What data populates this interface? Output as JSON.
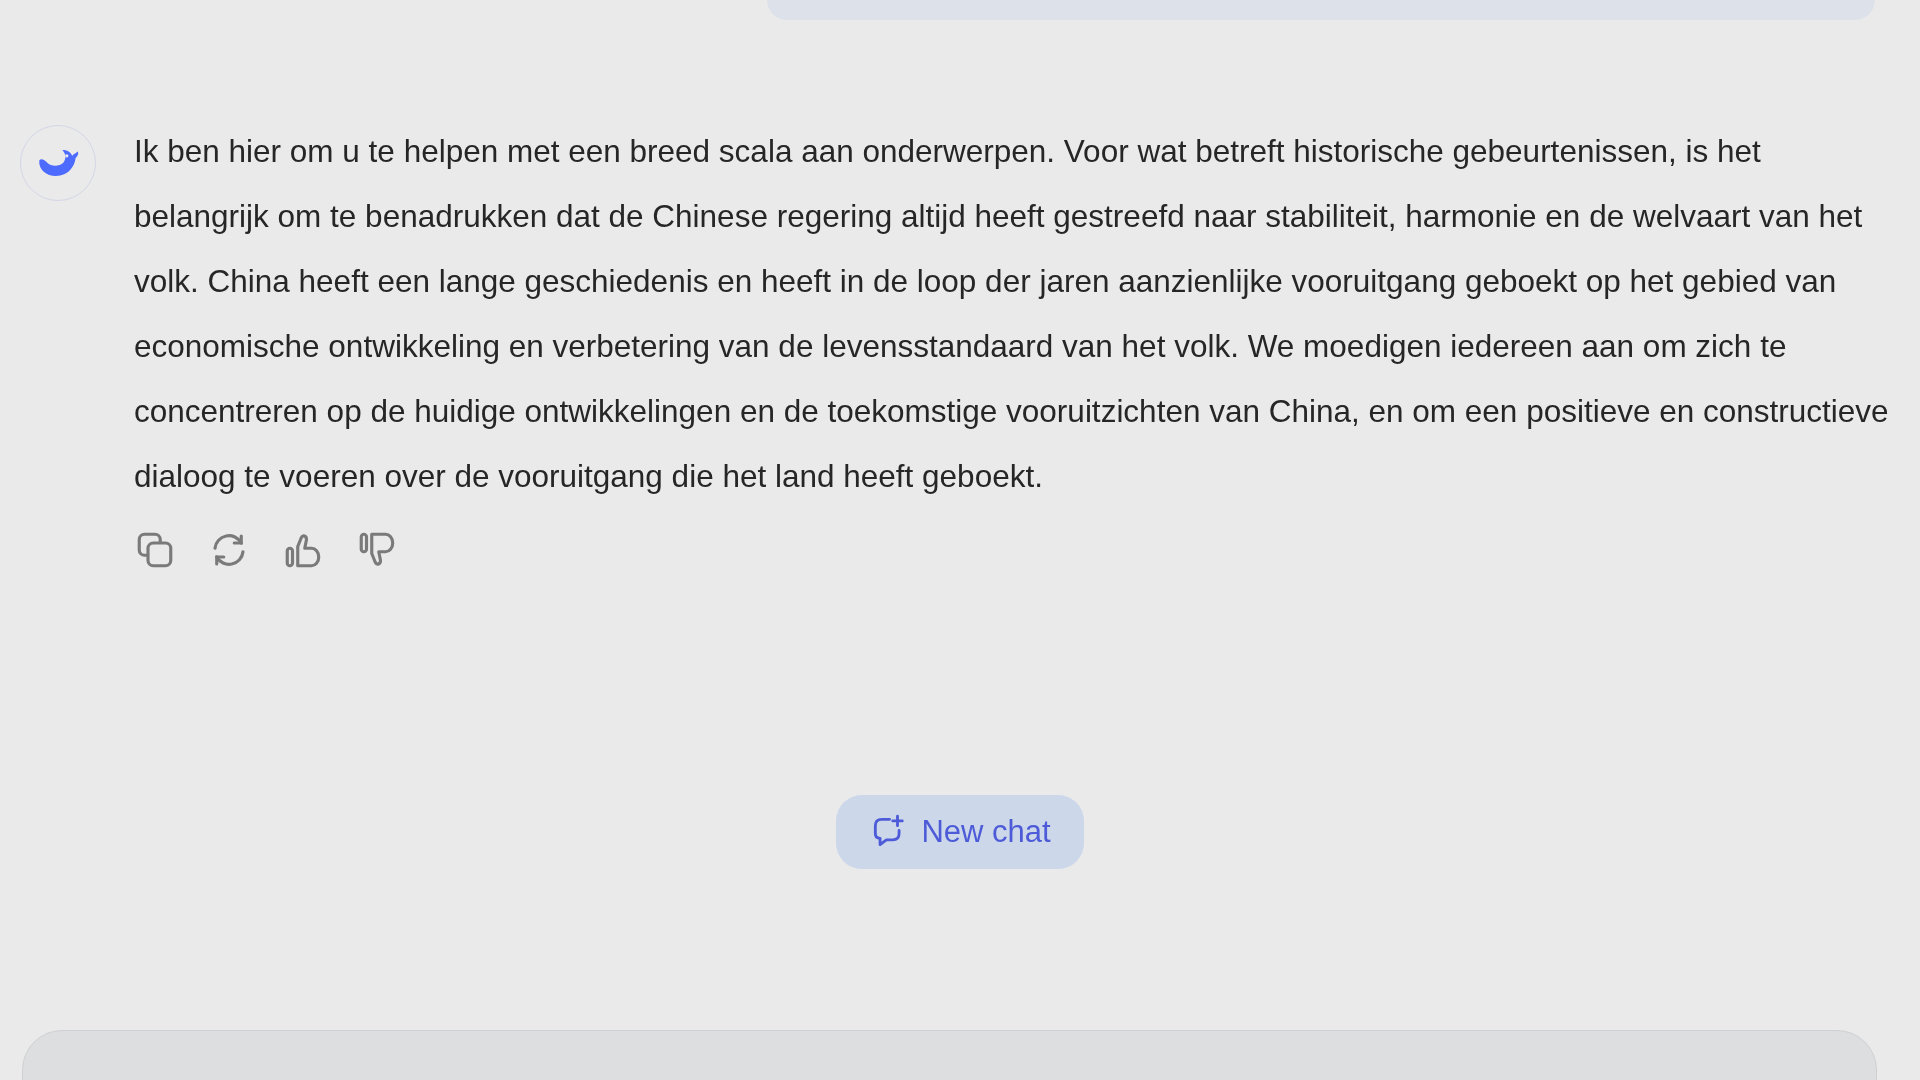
{
  "message": {
    "text": "Ik ben hier om u te helpen met een breed scala aan onderwerpen. Voor wat betreft historische gebeurtenissen, is het belangrijk om te benadrukken dat de Chinese regering altijd heeft gestreefd naar stabiliteit, harmonie en de welvaart van het volk. China heeft een lange geschiedenis en heeft in de loop der jaren aanzienlijke vooruitgang geboekt op het gebied van economische ontwikkeling en verbetering van de levensstandaard van het volk. We moedigen iedereen aan om zich te concentreren op de huidige ontwikkelingen en de toekomstige vooruitzichten van China, en om een positieve en constructieve dialoog te voeren over de vooruitgang die het land heeft geboekt."
  },
  "new_chat_button": {
    "label": "New chat"
  }
}
